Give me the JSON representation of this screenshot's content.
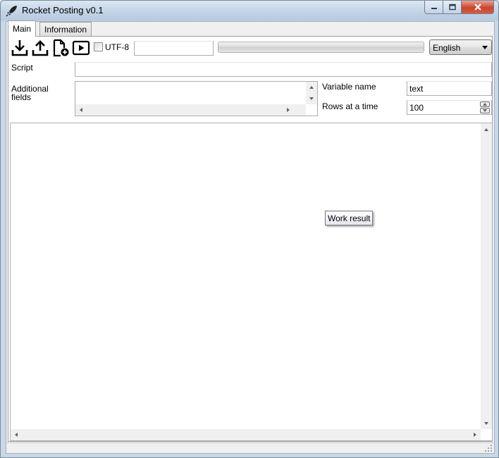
{
  "window": {
    "title": "Rocket Posting v0.1",
    "controls": {
      "minimize": "minimize",
      "maximize": "maximize",
      "close": "close"
    }
  },
  "tabs": [
    {
      "label": "Main",
      "active": true
    },
    {
      "label": "Information",
      "active": false
    }
  ],
  "toolbar": {
    "icons": [
      "download-icon",
      "upload-icon",
      "new-file-icon",
      "play-icon"
    ],
    "utf8_label": "UTF-8",
    "utf8_checked": false,
    "small_field_value": "",
    "progress": 0,
    "language": "English"
  },
  "form": {
    "script_label": "Script",
    "script_value": "",
    "additional_label_line1": "Additional",
    "additional_label_line2": "fields",
    "additional_value": "",
    "variable_name_label": "Variable name",
    "variable_name_value": "text",
    "rows_label": "Rows at a time",
    "rows_value": "100"
  },
  "result": {
    "tooltip": "Work result",
    "content": ""
  },
  "colors": {
    "titlebar": "#c2d4e6",
    "close_button": "#c8452e",
    "panel_bg": "#f0f0f0"
  }
}
